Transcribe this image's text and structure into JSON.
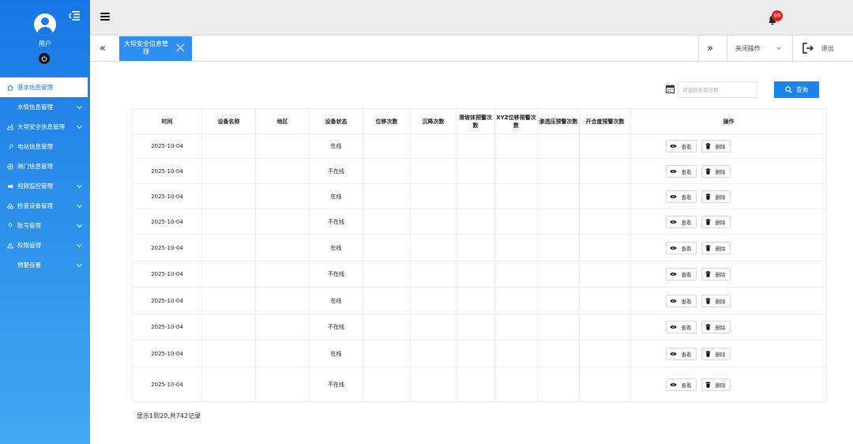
{
  "sidebar": {
    "user_name": "用户",
    "items": [
      {
        "label": "基本信息管理",
        "icon": "home-icon",
        "active": true,
        "has_sub": false
      },
      {
        "label": "水情信息管理",
        "icon": "water-drop-icon",
        "active": false,
        "has_sub": true
      },
      {
        "label": "大坝安全信息管理",
        "icon": "dam-icon",
        "active": false,
        "has_sub": true
      },
      {
        "label": "电站信息管理",
        "icon": "power-station-icon",
        "active": false,
        "has_sub": false
      },
      {
        "label": "闸门信息管理",
        "icon": "gate-icon",
        "active": false,
        "has_sub": false
      },
      {
        "label": "视频监控管理",
        "icon": "camera-icon",
        "active": false,
        "has_sub": true
      },
      {
        "label": "检查设备管理",
        "icon": "inspection-icon",
        "active": false,
        "has_sub": true
      },
      {
        "label": "账号管理",
        "icon": "user-icon",
        "active": false,
        "has_sub": true
      },
      {
        "label": "权限管理",
        "icon": "permission-icon",
        "active": false,
        "has_sub": true
      },
      {
        "label": "预警设置",
        "icon": "alert-icon",
        "active": false,
        "has_sub": true
      }
    ]
  },
  "header": {
    "notification_count": "99"
  },
  "tabs": {
    "active_label": "大坝安全信息管理",
    "close_ops_label": "关闭操作",
    "exit_label": "退出"
  },
  "search": {
    "date_placeholder": "请选择查询日期",
    "button_label": "查询"
  },
  "table": {
    "columns": [
      "时间",
      "设备名称",
      "地区",
      "设备状态",
      "位移次数",
      "沉降次数",
      "滑坡体预警次数",
      "XYZ位移预警次数",
      "渗透压预警次数",
      "开合度预警次数",
      "操作"
    ],
    "view_label": "查看",
    "delete_label": "删除",
    "rows": [
      {
        "time": "2025-10-04",
        "device": "",
        "region": "",
        "status": "在线",
        "displacement": "",
        "settlement": "",
        "landslide": "",
        "xyz": "",
        "seepage": "",
        "opening": ""
      },
      {
        "time": "2025-10-04",
        "device": "",
        "region": "",
        "status": "不在线",
        "displacement": "",
        "settlement": "",
        "landslide": "",
        "xyz": "",
        "seepage": "",
        "opening": ""
      },
      {
        "time": "2025-10-04",
        "device": "",
        "region": "",
        "status": "在线",
        "displacement": "",
        "settlement": "",
        "landslide": "",
        "xyz": "",
        "seepage": "",
        "opening": ""
      },
      {
        "time": "2025-10-04",
        "device": "",
        "region": "",
        "status": "不在线",
        "displacement": "",
        "settlement": "",
        "landslide": "",
        "xyz": "",
        "seepage": "",
        "opening": ""
      },
      {
        "time": "2025-10-04",
        "device": "",
        "region": "",
        "status": "在线",
        "displacement": "",
        "settlement": "",
        "landslide": "",
        "xyz": "",
        "seepage": "",
        "opening": ""
      },
      {
        "time": "2025-10-04",
        "device": "",
        "region": "",
        "status": "不在线",
        "displacement": "",
        "settlement": "",
        "landslide": "",
        "xyz": "",
        "seepage": "",
        "opening": ""
      },
      {
        "time": "2025-10-04",
        "device": "",
        "region": "",
        "status": "在线",
        "displacement": "",
        "settlement": "",
        "landslide": "",
        "xyz": "",
        "seepage": "",
        "opening": ""
      },
      {
        "time": "2025-10-04",
        "device": "",
        "region": "",
        "status": "不在线",
        "displacement": "",
        "settlement": "",
        "landslide": "",
        "xyz": "",
        "seepage": "",
        "opening": ""
      },
      {
        "time": "2025-10-04",
        "device": "",
        "region": "",
        "status": "在线",
        "displacement": "",
        "settlement": "",
        "landslide": "",
        "xyz": "",
        "seepage": "",
        "opening": ""
      },
      {
        "time": "2025-10-04",
        "device": "",
        "region": "",
        "status": "不在线",
        "displacement": "",
        "settlement": "",
        "landslide": "",
        "xyz": "",
        "seepage": "",
        "opening": ""
      }
    ]
  },
  "footer": {
    "summary": "显示1到20,共742记录"
  }
}
